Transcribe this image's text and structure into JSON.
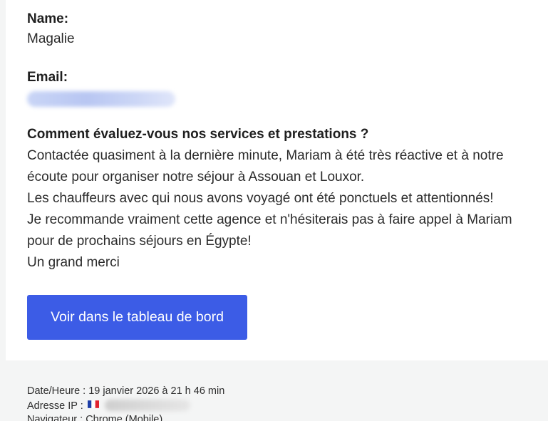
{
  "name": {
    "label": "Name:",
    "value": "Magalie"
  },
  "email": {
    "label": "Email:",
    "value": ""
  },
  "question": {
    "label": "Comment évaluez-vous nos services et prestations ?",
    "lines": [
      "Contactée quasiment à la dernière minute, Mariam à été très réactive et à notre",
      "écoute pour organiser notre séjour à Assouan et Louxor.",
      "Les chauffeurs avec qui nous avons voyagé ont été ponctuels et attentionnés!",
      "Je recommande vraiment cette agence et n'hésiterais pas à faire appel à Mariam",
      "pour de prochains séjours en Égypte!",
      "Un grand merci"
    ]
  },
  "button": {
    "label": "Voir dans le tableau de bord"
  },
  "footer": {
    "datetime": "Date/Heure : 19 janvier 2026 à 21 h 46 min",
    "ip_label": "Adresse IP :",
    "flag_icon": "france-flag-icon",
    "browser_partial": "Navigateur : Chrome (Mobile)"
  },
  "colors": {
    "accent": "#3c5ce6",
    "background": "#f4f5f5"
  }
}
